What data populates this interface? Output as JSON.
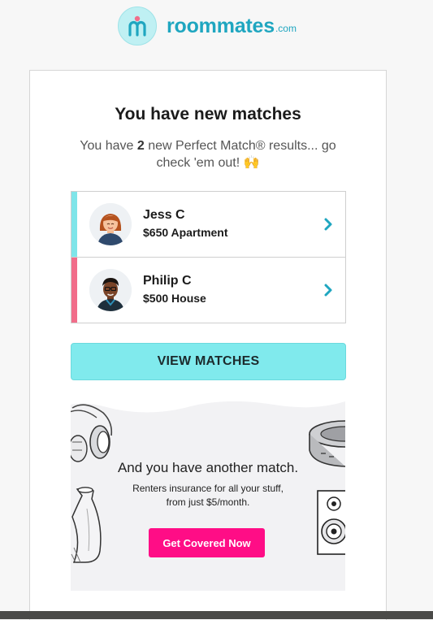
{
  "brand": {
    "name": "roommates",
    "tld": ".com",
    "color": "#1fa6c0",
    "mark_color": "#bff0f3",
    "icon": "roommates-logo-icon"
  },
  "email": {
    "title": "You have new matches",
    "subtitle_pre": "You have ",
    "subtitle_count": "2",
    "subtitle_post": " new Perfect Match® results... go check 'em out! 🙌"
  },
  "matches": [
    {
      "name": "Jess C",
      "detail": "$650 Apartment",
      "accent": "#7fe5e9",
      "icon": "chevron-right-icon"
    },
    {
      "name": "Philip C",
      "detail": "$500 House",
      "accent": "#f16d8a",
      "icon": "chevron-right-icon"
    }
  ],
  "cta": {
    "label": "VIEW MATCHES",
    "color": "#80eaed"
  },
  "promo": {
    "title": "And you have another match.",
    "text": "Renters insurance for all your stuff, from just $5/month.",
    "button": "Get Covered Now",
    "button_color": "#ff0d86",
    "icons": [
      "headphones-icon",
      "vase-icon",
      "robot-vacuum-icon",
      "speaker-icon"
    ]
  }
}
